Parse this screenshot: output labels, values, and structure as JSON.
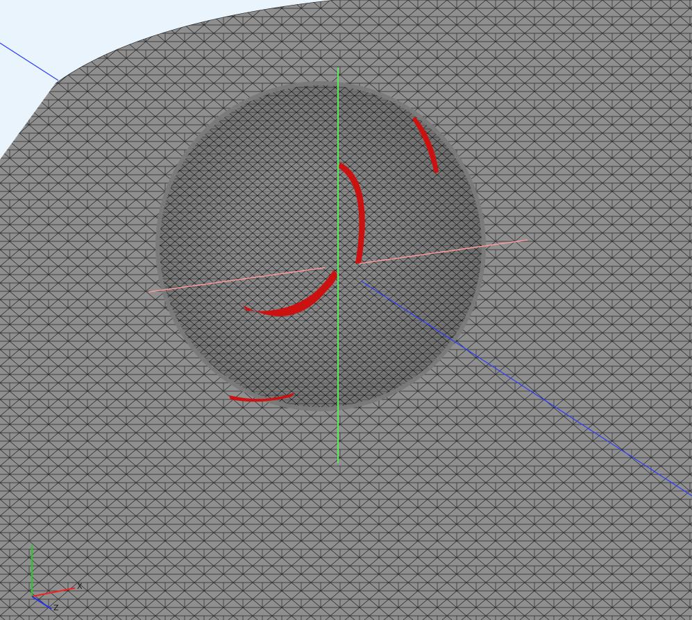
{
  "viewport": {
    "background_color": "#eaf4fd",
    "surface_color": "#8f8f8f",
    "mesh_edge_color": "#0b0b0b",
    "highlight_color": "#cc1111"
  },
  "axes": {
    "x_color": "#ff9a9a",
    "y_color": "#55ee55",
    "z_color": "#2a3cff"
  },
  "triad": {
    "x_label": "X",
    "z_label": "Z",
    "x_color": "#ee2222",
    "y_color": "#22cc22",
    "z_color": "#2233ee"
  }
}
